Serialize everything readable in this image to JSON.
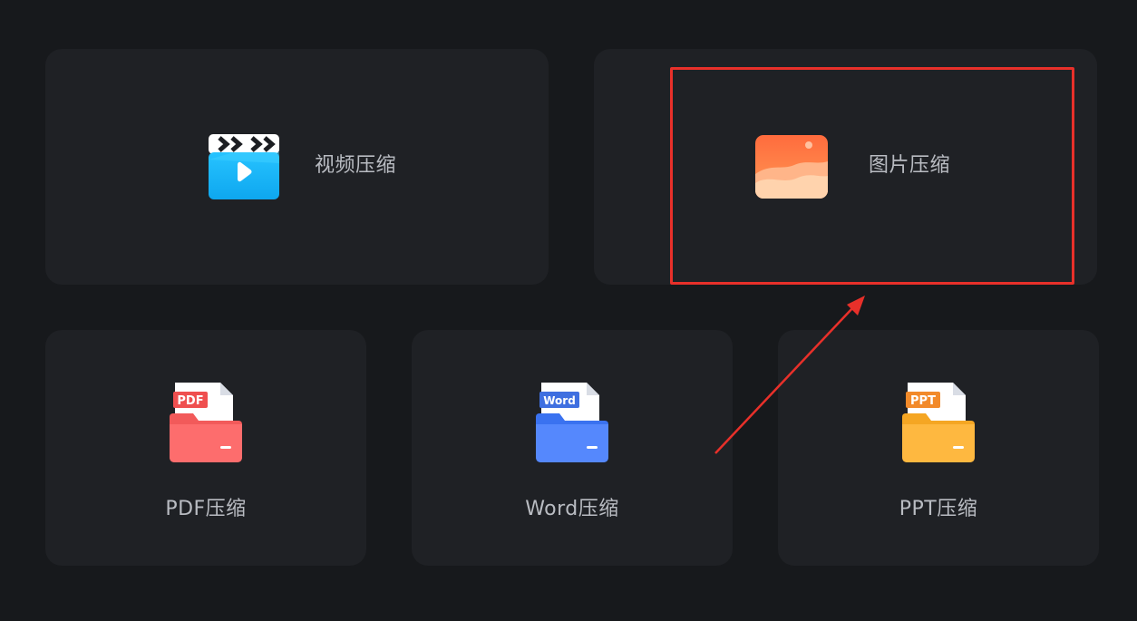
{
  "cards": {
    "video": {
      "label": "视频压缩",
      "icon": "video-clapper-icon",
      "accent": "#1fb6f5"
    },
    "image": {
      "label": "图片压缩",
      "icon": "image-photo-icon",
      "accent": "#ff7a45"
    },
    "pdf": {
      "label": "PDF压缩",
      "icon": "pdf-folder-icon",
      "badge": "PDF",
      "accent": "#f25a5a"
    },
    "word": {
      "label": "Word压缩",
      "icon": "word-folder-icon",
      "badge": "Word",
      "accent": "#3f7cf7"
    },
    "ppt": {
      "label": "PPT压缩",
      "icon": "ppt-folder-icon",
      "badge": "PPT",
      "accent": "#ffa726"
    }
  },
  "annotation": {
    "highlight_color": "#e8302a",
    "highlighted_card": "image"
  },
  "colors": {
    "background": "#17191c",
    "card": "#1f2125",
    "text": "#b9bcc2"
  }
}
